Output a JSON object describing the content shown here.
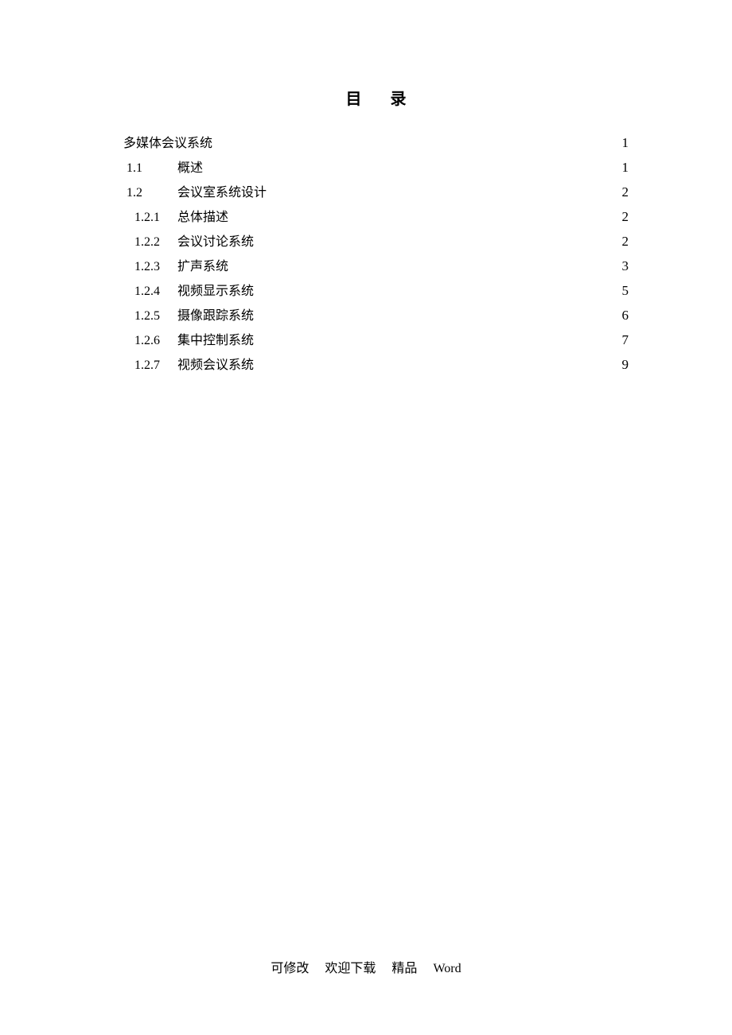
{
  "title": "目录",
  "toc": [
    {
      "level": 0,
      "number": "",
      "label": "多媒体会议系统",
      "page": "1"
    },
    {
      "level": 1,
      "number": "1.1",
      "label": "概述",
      "page": "1"
    },
    {
      "level": 1,
      "number": "1.2",
      "label": "会议室系统设计",
      "page": "2"
    },
    {
      "level": 2,
      "number": "1.2.1",
      "label": "总体描述",
      "page": "2"
    },
    {
      "level": 2,
      "number": "1.2.2",
      "label": "会议讨论系统",
      "page": "2"
    },
    {
      "level": 2,
      "number": "1.2.3",
      "label": "扩声系统",
      "page": "3"
    },
    {
      "level": 2,
      "number": "1.2.4",
      "label": "视频显示系统",
      "page": "5"
    },
    {
      "level": 2,
      "number": "1.2.5",
      "label": "摄像跟踪系统",
      "page": "6"
    },
    {
      "level": 2,
      "number": "1.2.6",
      "label": "集中控制系统",
      "page": "7"
    },
    {
      "level": 2,
      "number": "1.2.7",
      "label": "视频会议系统",
      "page": "9"
    }
  ],
  "footer": {
    "seg1": "可修改",
    "seg2": "欢迎下载",
    "seg3": "精品",
    "seg4": "Word"
  }
}
